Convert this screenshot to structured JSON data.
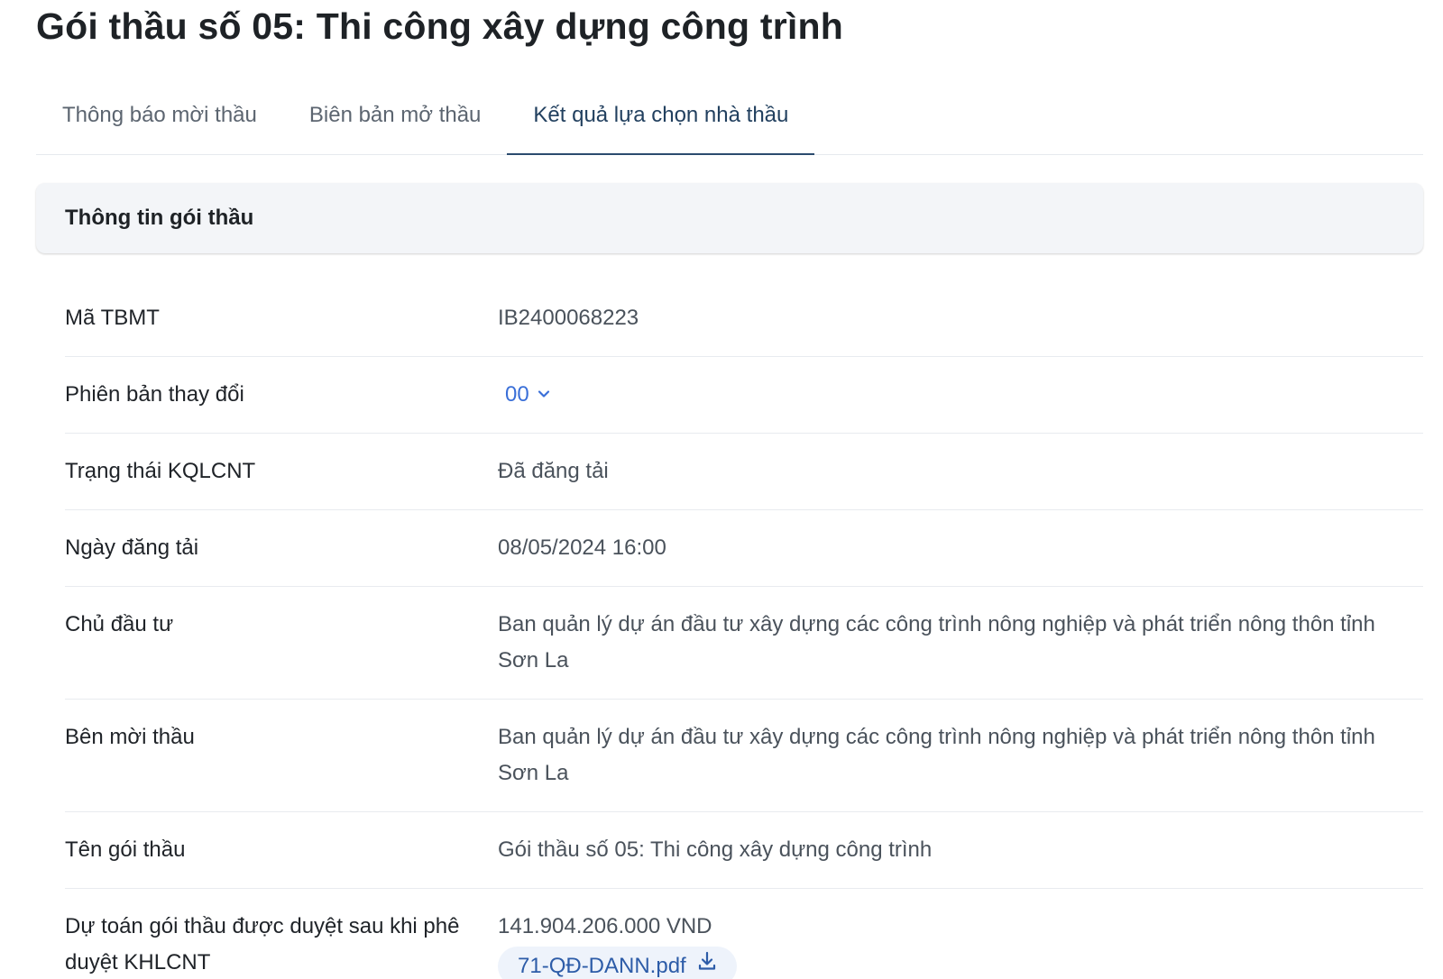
{
  "page": {
    "title": "Gói thầu số 05: Thi công xây dựng công trình"
  },
  "tabs": [
    {
      "label": "Thông báo mời thầu",
      "active": false
    },
    {
      "label": "Biên bản mở thầu",
      "active": false
    },
    {
      "label": "Kết quả lựa chọn nhà thầu",
      "active": true
    }
  ],
  "section": {
    "title": "Thông tin gói thầu"
  },
  "fields": {
    "ma_tbmt": {
      "label": "Mã TBMT",
      "value": "IB2400068223"
    },
    "phien_ban": {
      "label": "Phiên bản thay đổi",
      "value": "00",
      "icon": "chevron-down-icon"
    },
    "trang_thai": {
      "label": "Trạng thái KQLCNT",
      "value": "Đã đăng tải"
    },
    "ngay_dang_tai": {
      "label": "Ngày đăng tải",
      "value": "08/05/2024 16:00"
    },
    "chu_dau_tu": {
      "label": "Chủ đầu tư",
      "value": "Ban quản lý dự án đầu tư xây dựng các công trình nông nghiệp và phát triển nông thôn tỉnh Sơn La"
    },
    "ben_moi_thau": {
      "label": "Bên mời thầu",
      "value": "Ban quản lý dự án đầu tư xây dựng các công trình nông nghiệp và phát triển nông thôn tỉnh Sơn La"
    },
    "ten_goi_thau": {
      "label": "Tên gói thầu",
      "value": "Gói thầu số 05: Thi công xây dựng công trình"
    },
    "du_toan": {
      "label": "Dự toán gói thầu được duyệt sau khi phê duyệt KHLCNT",
      "value": "141.904.206.000 VND",
      "attachment": "71-QĐ-DANN.pdf",
      "attachment_icon": "download-icon"
    }
  },
  "colors": {
    "accent_link": "#3a6fd8",
    "tab_active": "#22405f",
    "chip_bg": "#eef3fb"
  }
}
